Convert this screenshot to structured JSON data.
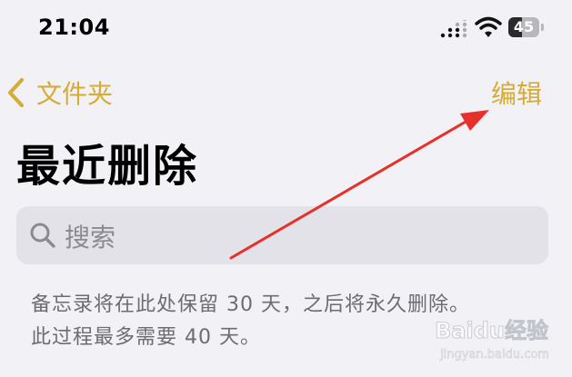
{
  "status_bar": {
    "time": "21:04",
    "battery_level": "45"
  },
  "nav": {
    "back_label": "文件夹",
    "edit_label": "编辑"
  },
  "title": "最近删除",
  "search": {
    "placeholder": "搜索"
  },
  "info_lines": [
    "备忘录将在此处保留 30 天，之后将永久删除。",
    "此过程最多需要 40 天。"
  ],
  "watermark": {
    "text": "Baidu经验",
    "url": "jingyan.baidu.com"
  },
  "colors": {
    "accent": "#d4ac36",
    "background": "#f2f1f6",
    "search_bg": "#e3e2e8",
    "secondary_text": "#6d6c72",
    "annotation": "#e8302a"
  },
  "icons": [
    "chevron-left-icon",
    "search-icon",
    "signal-icon",
    "wifi-icon",
    "battery-icon",
    "arrow-annotation"
  ]
}
